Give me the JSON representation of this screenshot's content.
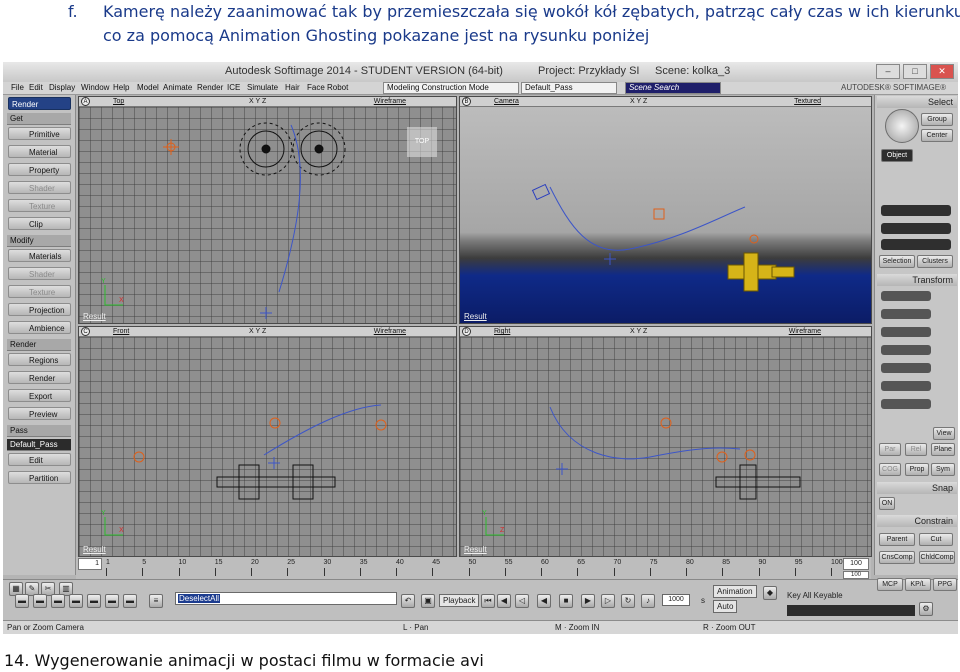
{
  "document": {
    "item_marker": "f.",
    "line1": "Kamerę należy zaanimować tak by przemieszczała się wokół kół zębatych, patrząc cały czas w ich kierunku",
    "line2": "co za pomocą Animation Ghosting pokazane jest na rysunku poniżej",
    "footer": "14. Wygenerowanie animacji w postaci filmu w formacie avi"
  },
  "app": {
    "title": "Autodesk Softimage 2014 - STUDENT VERSION (64-bit)",
    "project": "Project: Przykłady SI",
    "scene": "Scene: kolka_3",
    "brand": "AUTODESK® SOFTIMAGE®",
    "window_buttons": [
      "–",
      "□",
      "✕"
    ]
  },
  "menubar": {
    "items": [
      "File",
      "Edit",
      "Display",
      "Window",
      "Help",
      "Model",
      "Animate",
      "Render",
      "ICE",
      "Simulate",
      "Hair",
      "Face Robot"
    ],
    "construction_mode": "Modeling Construction Mode",
    "pass": "Default_Pass",
    "scene_search": "Scene Search"
  },
  "left_panel": {
    "mode": "Render",
    "items": [
      {
        "label": "Get",
        "kind": "head"
      },
      {
        "label": "Primitive",
        "kind": "item"
      },
      {
        "label": "Material",
        "kind": "item"
      },
      {
        "label": "Property",
        "kind": "item"
      },
      {
        "label": "Shader",
        "kind": "dim"
      },
      {
        "label": "Texture",
        "kind": "dim"
      },
      {
        "label": "Clip",
        "kind": "item"
      },
      {
        "label": "Modify",
        "kind": "head"
      },
      {
        "label": "Materials",
        "kind": "item"
      },
      {
        "label": "Shader",
        "kind": "dim"
      },
      {
        "label": "Texture",
        "kind": "dim"
      },
      {
        "label": "Projection",
        "kind": "item"
      },
      {
        "label": "Ambience",
        "kind": "item"
      },
      {
        "label": "Render",
        "kind": "head"
      },
      {
        "label": "Regions",
        "kind": "item"
      },
      {
        "label": "Render",
        "kind": "item"
      },
      {
        "label": "Export",
        "kind": "item"
      },
      {
        "label": "Preview",
        "kind": "item"
      },
      {
        "label": "Pass",
        "kind": "head"
      },
      {
        "label": "Default_Pass",
        "kind": "darkhead"
      },
      {
        "label": "Edit",
        "kind": "item"
      },
      {
        "label": "Partition",
        "kind": "item"
      }
    ]
  },
  "viewports": [
    {
      "letter": "A",
      "view": "Top",
      "axes": "X Y Z",
      "mode": "Wireframe",
      "footer": "Result",
      "badge": "TOP"
    },
    {
      "letter": "B",
      "view": "Camera",
      "axes": "X Y Z",
      "mode": "Textured",
      "footer": "Result"
    },
    {
      "letter": "C",
      "view": "Front",
      "axes": "X Y Z",
      "mode": "Wireframe",
      "footer": "Result"
    },
    {
      "letter": "D",
      "view": "Right",
      "axes": "X Y Z",
      "mode": "Wireframe",
      "footer": "Result"
    }
  ],
  "timeline": {
    "start": "1",
    "end": "100",
    "end_secondary": "100",
    "ticks": [
      "1",
      "5",
      "10",
      "15",
      "20",
      "25",
      "30",
      "35",
      "40",
      "45",
      "50",
      "55",
      "60",
      "65",
      "70",
      "75",
      "80",
      "85",
      "90",
      "95",
      "100"
    ]
  },
  "bottom_bar": {
    "command": "DeselectAll",
    "playback": "Playback",
    "frame": "1000",
    "frame_unit": "s",
    "animation": "Animation",
    "auto": "Auto",
    "key_all": "Key All Keyable"
  },
  "status": {
    "left": "Pan or Zoom Camera",
    "l_hint": "Pan",
    "m_hint": "Zoom IN",
    "r_hint": "Zoom OUT"
  },
  "right_panel": {
    "select": "Select",
    "group": "Group",
    "center": "Center",
    "object": "Object",
    "selection": "Selection",
    "clusters": "Clusters",
    "transform": "Transform",
    "view": "View",
    "par": "Par",
    "rel": "Rel",
    "plane": "Plane",
    "cog": "COG",
    "prop": "Prop",
    "sym": "Sym",
    "snap": "Snap",
    "on": "ON",
    "constrain": "Constrain",
    "parent": "Parent",
    "cut": "Cut",
    "cnscomp": "CnsComp",
    "chldcomp": "ChldComp",
    "mcp": "MCP",
    "kpl": "KP/L",
    "ppg": "PPG"
  },
  "colors": {
    "doc_text": "#1a3a8a",
    "selection_blue": "#1c3c8f",
    "gear_gold": "#d6b418",
    "path_blue": "#3c55c8",
    "null_orange": "#e0601a"
  }
}
